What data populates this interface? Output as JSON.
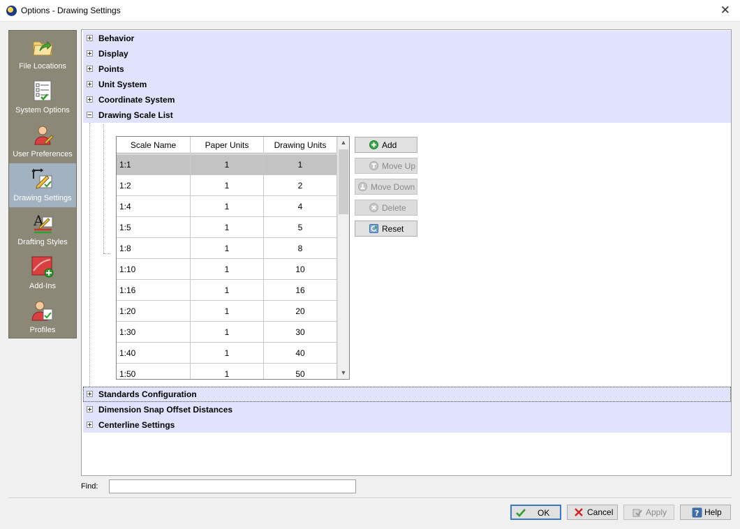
{
  "window": {
    "title": "Options - Drawing Settings",
    "close": "✕"
  },
  "nav": {
    "items": [
      {
        "label": "File Locations",
        "icon": "folder-arrow-icon",
        "selected": false
      },
      {
        "label": "System Options",
        "icon": "checklist-icon",
        "selected": false
      },
      {
        "label": "User Preferences",
        "icon": "user-pencil-icon",
        "selected": false
      },
      {
        "label": "Drawing Settings",
        "icon": "drawing-settings-icon",
        "selected": true
      },
      {
        "label": "Drafting Styles",
        "icon": "text-style-icon",
        "selected": false
      },
      {
        "label": "Add-Ins",
        "icon": "add-in-icon",
        "selected": false
      },
      {
        "label": "Profiles",
        "icon": "profile-icon",
        "selected": false
      }
    ]
  },
  "tree": {
    "categories_top": [
      {
        "label": "Behavior",
        "expanded": false
      },
      {
        "label": "Display",
        "expanded": false
      },
      {
        "label": "Points",
        "expanded": false
      },
      {
        "label": "Unit System",
        "expanded": false
      },
      {
        "label": "Coordinate System",
        "expanded": false
      },
      {
        "label": "Drawing Scale List",
        "expanded": true
      }
    ],
    "categories_bottom": [
      {
        "label": "Standards Configuration",
        "expanded": false,
        "focused": true
      },
      {
        "label": "Dimension Snap Offset Distances",
        "expanded": false
      },
      {
        "label": "Centerline Settings",
        "expanded": false
      }
    ]
  },
  "scale_table": {
    "headers": [
      "Scale Name",
      "Paper Units",
      "Drawing Units"
    ],
    "selected_row": 0,
    "rows": [
      [
        "1:1",
        "1",
        "1"
      ],
      [
        "1:2",
        "1",
        "2"
      ],
      [
        "1:4",
        "1",
        "4"
      ],
      [
        "1:5",
        "1",
        "5"
      ],
      [
        "1:8",
        "1",
        "8"
      ],
      [
        "1:10",
        "1",
        "10"
      ],
      [
        "1:16",
        "1",
        "16"
      ],
      [
        "1:20",
        "1",
        "20"
      ],
      [
        "1:30",
        "1",
        "30"
      ],
      [
        "1:40",
        "1",
        "40"
      ],
      [
        "1:50",
        "1",
        "50"
      ]
    ]
  },
  "scale_buttons": {
    "add": "Add",
    "move_up": "Move Up",
    "move_down": "Move Down",
    "delete": "Delete",
    "reset": "Reset"
  },
  "find": {
    "label": "Find:",
    "value": ""
  },
  "dialog_buttons": {
    "ok": "OK",
    "cancel": "Cancel",
    "apply": "Apply",
    "help": "Help"
  },
  "colors": {
    "nav_background": "#8b8877",
    "nav_selected": "#a2b2c0",
    "category_background": "#e0e3fb",
    "row_selected": "#c3c3c3",
    "ok_border": "#3b79c4"
  }
}
